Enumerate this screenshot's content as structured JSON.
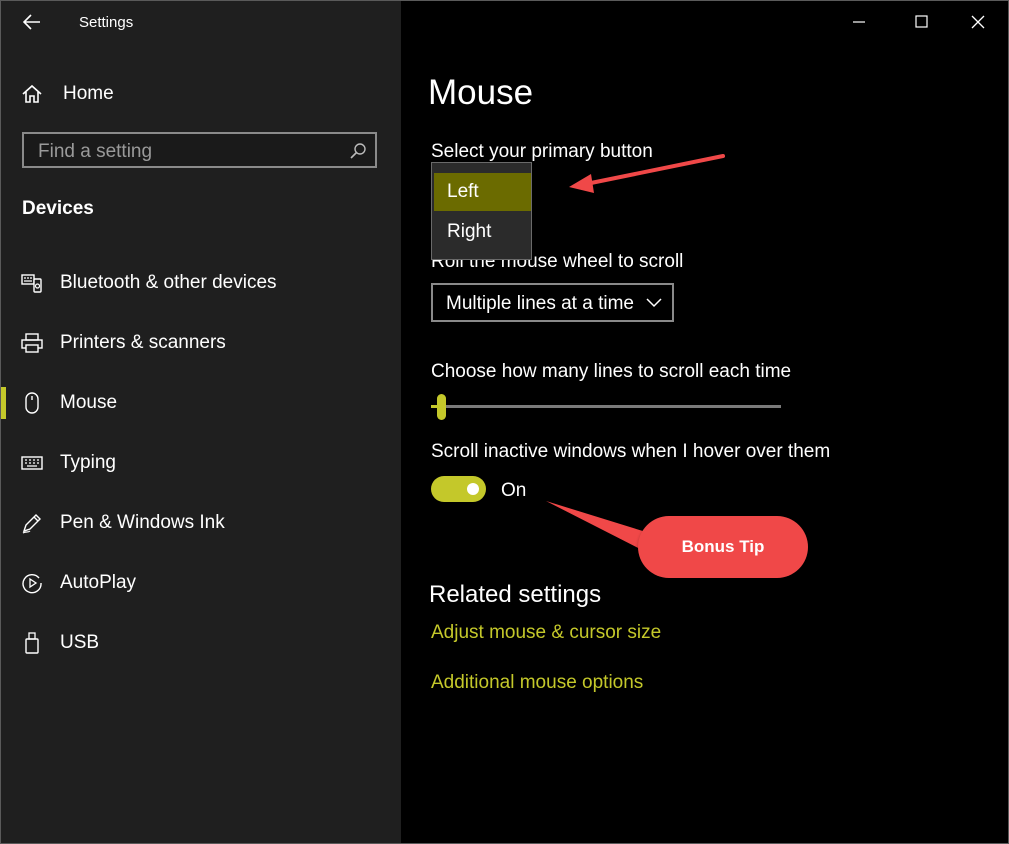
{
  "window": {
    "title": "Settings"
  },
  "sidebar": {
    "home_label": "Home",
    "search_placeholder": "Find a setting",
    "section_title": "Devices",
    "items": [
      {
        "label": "Bluetooth & other devices",
        "icon": "bluetooth-devices-icon",
        "selected": false
      },
      {
        "label": "Printers & scanners",
        "icon": "printer-icon",
        "selected": false
      },
      {
        "label": "Mouse",
        "icon": "mouse-icon",
        "selected": true
      },
      {
        "label": "Typing",
        "icon": "keyboard-icon",
        "selected": false
      },
      {
        "label": "Pen & Windows Ink",
        "icon": "pen-icon",
        "selected": false
      },
      {
        "label": "AutoPlay",
        "icon": "autoplay-icon",
        "selected": false
      },
      {
        "label": "USB",
        "icon": "usb-icon",
        "selected": false
      }
    ]
  },
  "main": {
    "page_title": "Mouse",
    "primary_button": {
      "label": "Select your primary button",
      "options": [
        "Left",
        "Right"
      ],
      "selected": "Left"
    },
    "scroll_wheel": {
      "label": "Roll the mouse wheel to scroll",
      "value": "Multiple lines at a time"
    },
    "lines_to_scroll": {
      "label": "Choose how many lines to scroll each time",
      "level_fraction": 0.02
    },
    "scroll_inactive": {
      "label": "Scroll inactive windows when I hover over them",
      "state": "On"
    },
    "related": {
      "title": "Related settings",
      "links": [
        "Adjust mouse & cursor size",
        "Additional mouse options"
      ]
    }
  },
  "annotation": {
    "callout_text": "Bonus Tip"
  },
  "colors": {
    "accent": "#c4c82a",
    "selected_option_bg": "#6b6b00",
    "sidebar_bg": "#1f1f1f",
    "main_bg": "#000000",
    "callout": "#f04848"
  }
}
